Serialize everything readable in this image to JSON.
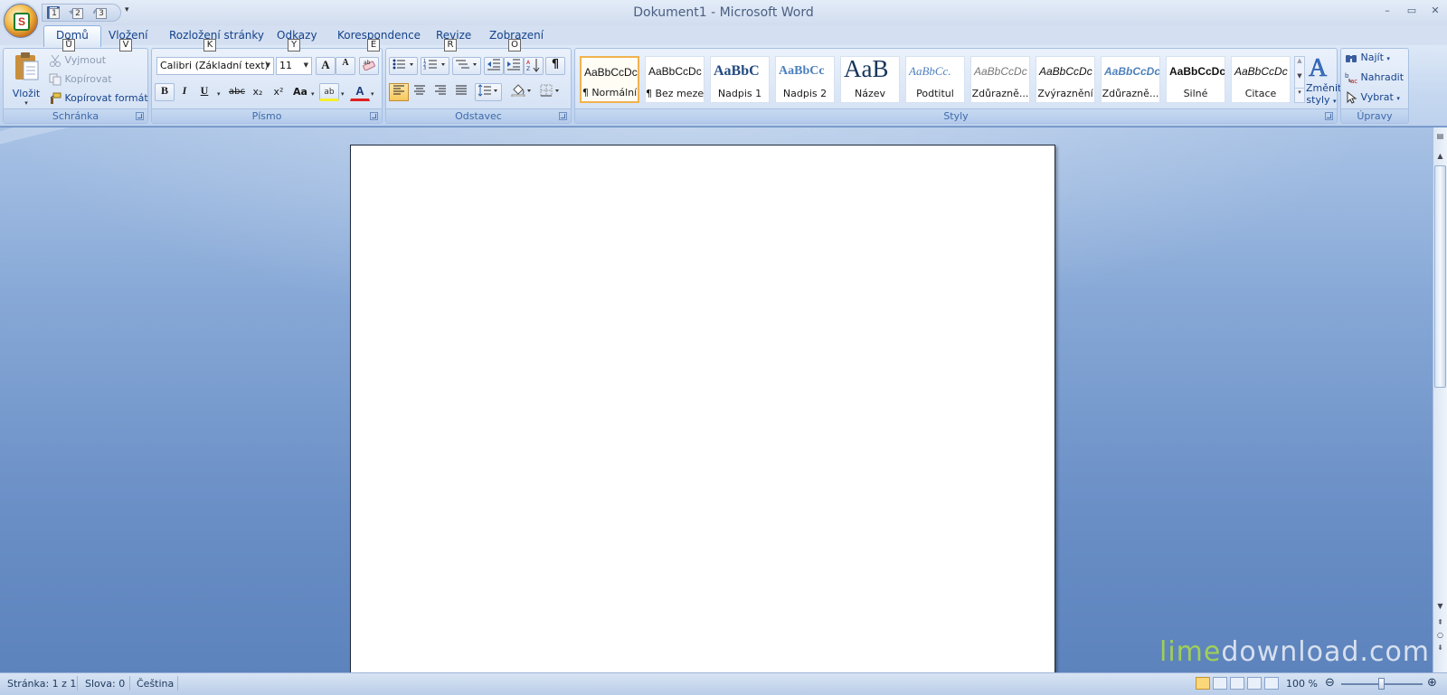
{
  "window": {
    "title": "Dokument1 - Microsoft Word",
    "controls": {
      "minimize": "–",
      "restore": "▭",
      "close": "✕"
    }
  },
  "office_button": {
    "icon": "office-logo-icon",
    "key_tip": "S"
  },
  "quick_access": {
    "items": [
      {
        "icon": "save-icon",
        "key_tip": "1"
      },
      {
        "icon": "undo-icon",
        "key_tip": "2"
      },
      {
        "icon": "redo-icon",
        "key_tip": "3"
      }
    ],
    "more": "▾"
  },
  "tabs": [
    {
      "label": "Domů",
      "key_tip": "Ů",
      "active": true
    },
    {
      "label": "Vložení",
      "key_tip": "V"
    },
    {
      "label": "Rozložení stránky",
      "key_tip": "K"
    },
    {
      "label": "Odkazy",
      "key_tip": "Y"
    },
    {
      "label": "Korespondence",
      "key_tip": "E"
    },
    {
      "label": "Revize",
      "key_tip": "R"
    },
    {
      "label": "Zobrazení",
      "key_tip": "O"
    }
  ],
  "help": "?",
  "ribbon": {
    "clipboard": {
      "label": "Schránka",
      "paste": "Vložit",
      "cut": "Vyjmout",
      "copy": "Kopírovat",
      "format_painter": "Kopírovat formát"
    },
    "font": {
      "label": "Písmo",
      "font_name": "Calibri (Základní text)",
      "font_size": "11",
      "grow": "A",
      "shrink": "A",
      "bold": "B",
      "italic": "I",
      "underline": "U",
      "strike": "abc",
      "subscript": "x₂",
      "superscript": "x²",
      "change_case": "Aa",
      "highlight": "ab",
      "font_color": "A"
    },
    "paragraph": {
      "label": "Odstavec",
      "pilcrow": "¶"
    },
    "styles": {
      "label": "Styly",
      "items": [
        {
          "sample": "AaBbCcDc",
          "name": "¶ Normální",
          "selected": true
        },
        {
          "sample": "AaBbCcDc",
          "name": "¶ Bez mezer"
        },
        {
          "sample": "AaBbC",
          "name": "Nadpis 1"
        },
        {
          "sample": "AaBbCc",
          "name": "Nadpis 2"
        },
        {
          "sample": "AaB",
          "name": "Název"
        },
        {
          "sample": "AaBbCc.",
          "name": "Podtitul"
        },
        {
          "sample": "AaBbCcDc",
          "name": "Zdůrazně..."
        },
        {
          "sample": "AaBbCcDc",
          "name": "Zvýraznění"
        },
        {
          "sample": "AaBbCcDc",
          "name": "Zdůrazně..."
        },
        {
          "sample": "AaBbCcDc",
          "name": "Silné"
        },
        {
          "sample": "AaBbCcDc",
          "name": "Citace"
        }
      ],
      "change_styles": "Změnit styly",
      "change_styles_line1": "Změnit",
      "change_styles_line2": "styly"
    },
    "editing": {
      "label": "Úpravy",
      "find": "Najít",
      "replace": "Nahradit",
      "select": "Vybrat"
    }
  },
  "statusbar": {
    "page": "Stránka: 1 z 1",
    "words": "Slova: 0",
    "language": "Čeština",
    "zoom": "100 %"
  },
  "watermark": {
    "part1": "lime",
    "part2": "download.com"
  },
  "colors": {
    "ribbon_bg": "#c6d8f0",
    "workspace": "#6a8fc6",
    "accent_selected": "#f0b34f",
    "text": "#15428b"
  }
}
